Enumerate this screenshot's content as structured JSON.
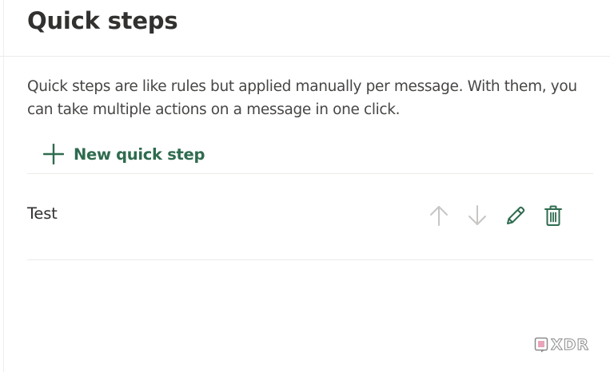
{
  "page": {
    "title": "Quick steps",
    "description": "Quick steps are like rules but applied manually per message. With them, you can take multiple actions on a message in one click."
  },
  "new_quick_step": {
    "label": "New quick step",
    "icon": "plus-icon"
  },
  "quick_steps": [
    {
      "name": "Test",
      "actions": {
        "move_up": {
          "icon": "arrow-up-icon",
          "enabled": false
        },
        "move_down": {
          "icon": "arrow-down-icon",
          "enabled": false
        },
        "edit": {
          "icon": "pencil-icon",
          "enabled": true
        },
        "delete": {
          "icon": "trash-icon",
          "enabled": true
        }
      }
    }
  ],
  "watermark": {
    "text": "XDR",
    "icon": "xda-logo-icon"
  },
  "colors": {
    "accent": "#2f6b4f",
    "disabled": "#c8c6c4",
    "text": "#323130",
    "divider": "#edebe9"
  }
}
